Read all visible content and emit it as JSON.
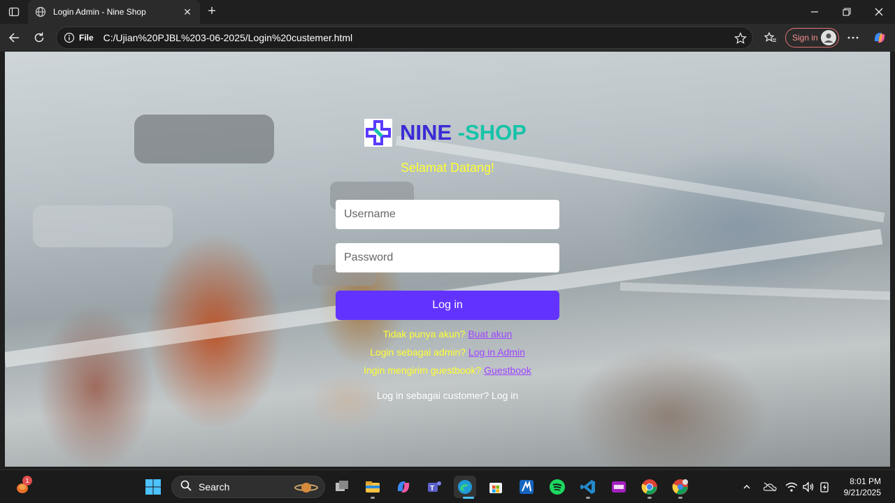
{
  "browser": {
    "tab_title": "Login Admin - Nine Shop",
    "url_scheme_label": "File",
    "url": "C:/Ujian%20PJBL%203-06-2025/Login%20custemer.html",
    "signin_label": "Sign in"
  },
  "page": {
    "brand_part1": "NINE ",
    "brand_part2": "-SHOP",
    "welcome": "Selamat Datang!",
    "username_placeholder": "Username",
    "password_placeholder": "Password",
    "login_button": "Log in",
    "links": [
      {
        "text": "Tidak punya akun?",
        "link": "Buat akun"
      },
      {
        "text": "Login sebagai admin?",
        "link": "Log in Admin"
      },
      {
        "text": "Ingin mengirim guestbook?",
        "link": "Guestbook"
      }
    ],
    "customer_text": "Log in sebagai customer?",
    "customer_link": "Log in"
  },
  "taskbar": {
    "search_label": "Search",
    "notification_count": "1",
    "time": "8:01 PM",
    "date": "9/21/2025"
  },
  "colors": {
    "accent_button": "#6233ff",
    "brand_primary": "#3b2bd6",
    "brand_secondary": "#17c3a8",
    "welcome_text": "#ffff33",
    "link": "#9d43ff"
  }
}
